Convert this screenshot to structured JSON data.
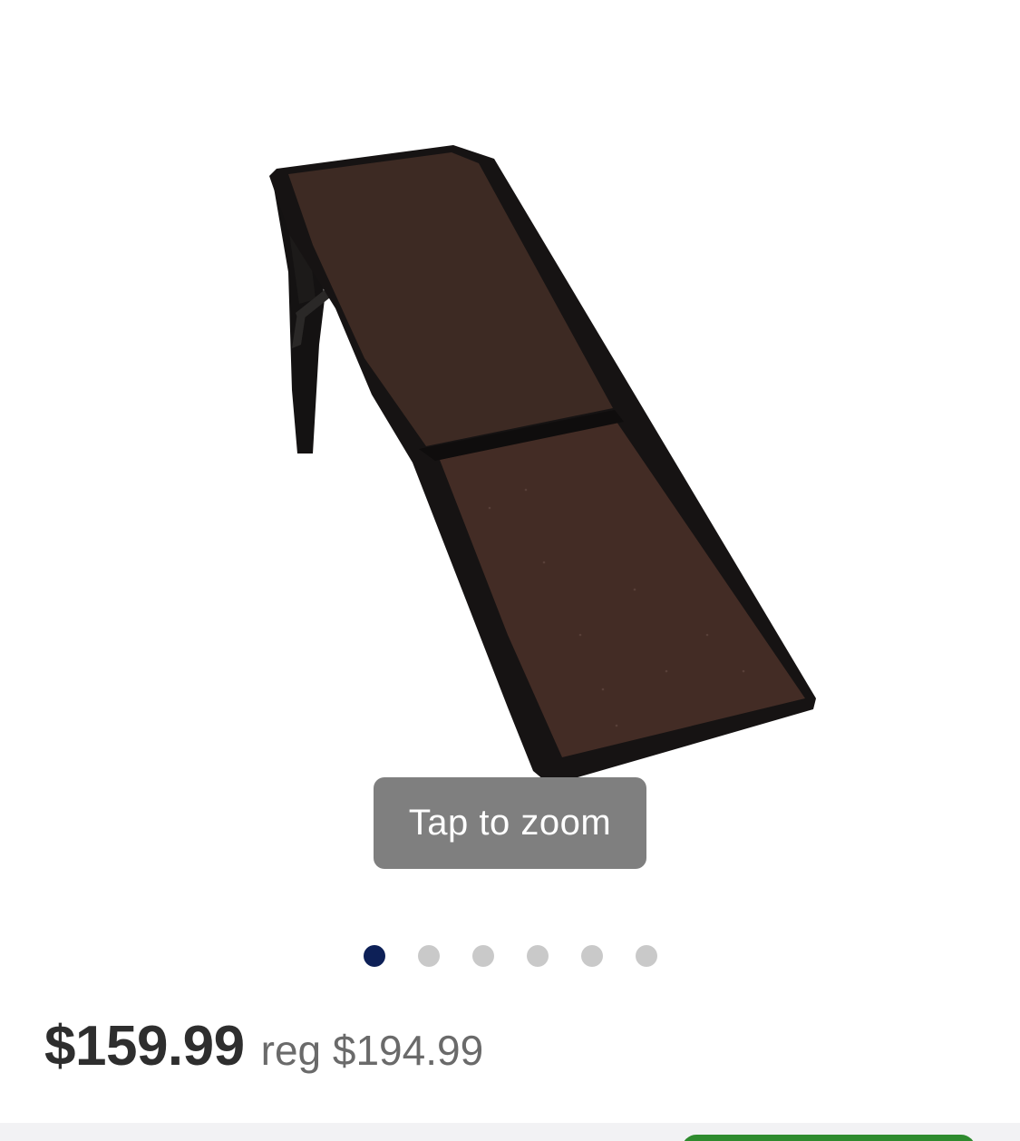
{
  "product": {
    "image_alt": "Dog ramp",
    "zoom_hint": "Tap to zoom",
    "gallery": {
      "total_images": 6,
      "active_index": 0
    },
    "price": "$159.99",
    "regular_price": "reg $194.99"
  },
  "colors": {
    "active_dot": "#0d2057",
    "inactive_dot": "#c9c9c9",
    "zoom_hint_bg": "#7f7f7f",
    "cta_green": "#2e8b2e"
  }
}
